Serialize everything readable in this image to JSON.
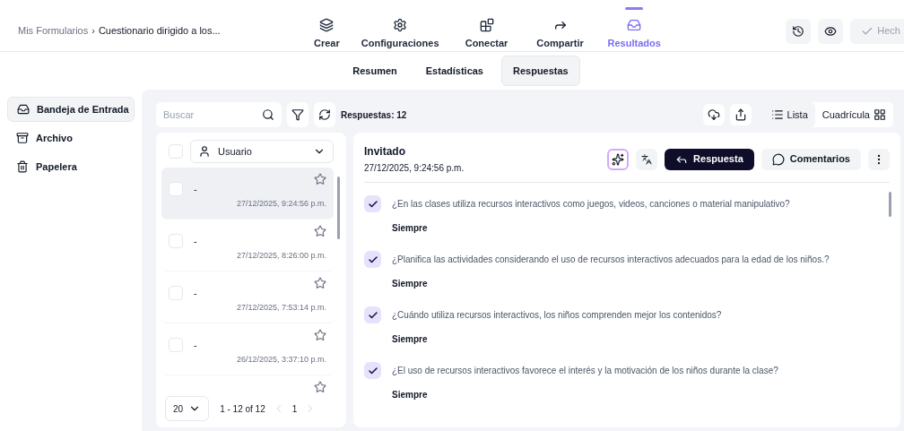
{
  "breadcrumb": {
    "root": "Mis Formularios",
    "separator": "›",
    "current": "Cuestionario dirigido a los..."
  },
  "nav_tabs": [
    {
      "label": "Crear",
      "selected": false
    },
    {
      "label": "Configuraciones",
      "selected": false
    },
    {
      "label": "Conectar",
      "selected": false
    },
    {
      "label": "Compartir",
      "selected": false
    },
    {
      "label": "Resultados",
      "selected": true
    }
  ],
  "done_button": {
    "label": "Hech"
  },
  "sub_tabs": [
    {
      "label": "Resumen",
      "selected": false
    },
    {
      "label": "Estadísticas",
      "selected": false
    },
    {
      "label": "Respuestas",
      "selected": true
    }
  ],
  "sidebar": {
    "items": [
      {
        "label": "Bandeja de Entrada",
        "selected": true
      },
      {
        "label": "Archivo",
        "selected": false
      },
      {
        "label": "Papelera",
        "selected": false
      }
    ]
  },
  "toolbar": {
    "search": {
      "placeholder": "Buscar"
    },
    "count": "Respuestas: 12",
    "views": [
      {
        "label": "Lista",
        "selected": true
      },
      {
        "label": "Cuadrícula",
        "selected": false
      }
    ]
  },
  "list": {
    "filter": "Usuario",
    "select_all_checked": false,
    "rows": [
      {
        "name": "-",
        "date": "27/12/2025, 9:24:56 p.m.",
        "selected": true,
        "checked": false,
        "starred": false
      },
      {
        "name": "-",
        "date": "27/12/2025, 8:26:00 p.m.",
        "selected": false,
        "checked": false,
        "starred": false
      },
      {
        "name": "-",
        "date": "27/12/2025, 7:53:14 p.m.",
        "selected": false,
        "checked": false,
        "starred": false
      },
      {
        "name": "-",
        "date": "26/12/2025, 3:37:10 p.m.",
        "selected": false,
        "checked": false,
        "starred": false
      },
      {
        "selected": false,
        "starred": false
      }
    ]
  },
  "pagination": {
    "page_size": "20",
    "range": "1 - 12 of 12",
    "page": "1"
  },
  "detail": {
    "name": "Invitado",
    "date": "27/12/2025, 9:24:56 p.m.",
    "reply_button": "Respuesta",
    "comments_button": "Comentarios",
    "answers": [
      {
        "question": "¿En las clases utiliza recursos interactivos como juegos, videos, canciones o material manipulativo?",
        "answer": "Siempre",
        "checked": true
      },
      {
        "question": "¿Planifica las actividades considerando el uso de recursos interactivos adecuados para la edad de los niños.?",
        "answer": "Siempre",
        "checked": true
      },
      {
        "question": "¿Cuándo utiliza recursos interactivos, los niños comprenden mejor los contenidos?",
        "answer": "Siempre",
        "checked": true
      },
      {
        "question": "¿El uso de recursos interactivos favorece el interés y la motivación de los niños durante la clase?",
        "answer": "Siempre",
        "checked": true
      }
    ]
  }
}
